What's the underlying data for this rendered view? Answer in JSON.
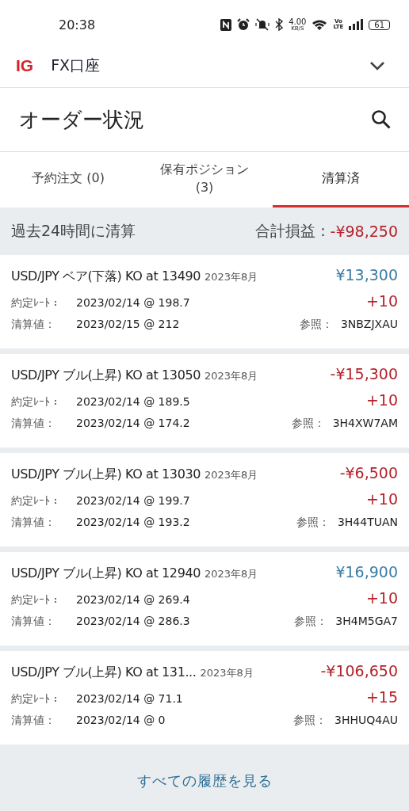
{
  "status_bar": {
    "time": "20:38",
    "speed_value": "4.00",
    "speed_unit": "KB/S",
    "volte_top": "Vo",
    "volte_bottom": "LTE",
    "battery": "61"
  },
  "account_bar": {
    "logo": "IG",
    "title": "FX口座"
  },
  "page": {
    "title": "オーダー状況"
  },
  "tabs": [
    {
      "label": "予約注文 (0)",
      "selected": false
    },
    {
      "label": "保有ポジション\n(3)",
      "selected": false
    },
    {
      "label": "清算済",
      "selected": true
    }
  ],
  "summary": {
    "label": "過去24時間に清算",
    "total_label": "合計損益：",
    "total_value": "-¥98,250"
  },
  "trades": [
    {
      "name": "USD/JPY ベア(下落) KO at 13490",
      "expiry": "2023年8月",
      "pnl": "¥13,300",
      "color": "#3a7ca5",
      "size": "+10",
      "open_label": "約定ﾚｰﾄ：",
      "open_value": "2023/02/14 @ 198.7",
      "close_label": "清算値：",
      "close_value": "2023/02/15 @ 212",
      "ref_label": "参照：",
      "ref_value": "3NBZJXAU"
    },
    {
      "name": "USD/JPY ブル(上昇) KO at 13050",
      "expiry": "2023年8月",
      "pnl": "-¥15,300",
      "color": "#b3222a",
      "size": "+10",
      "open_label": "約定ﾚｰﾄ：",
      "open_value": "2023/02/14 @ 189.5",
      "close_label": "清算値：",
      "close_value": "2023/02/14 @ 174.2",
      "ref_label": "参照：",
      "ref_value": "3H4XW7AM"
    },
    {
      "name": "USD/JPY ブル(上昇) KO at 13030",
      "expiry": "2023年8月",
      "pnl": "-¥6,500",
      "color": "#b3222a",
      "size": "+10",
      "open_label": "約定ﾚｰﾄ：",
      "open_value": "2023/02/14 @ 199.7",
      "close_label": "清算値：",
      "close_value": "2023/02/14 @ 193.2",
      "ref_label": "参照：",
      "ref_value": "3H44TUAN"
    },
    {
      "name": "USD/JPY ブル(上昇) KO at 12940",
      "expiry": "2023年8月",
      "pnl": "¥16,900",
      "color": "#3a7ca5",
      "size": "+10",
      "open_label": "約定ﾚｰﾄ：",
      "open_value": "2023/02/14 @ 269.4",
      "close_label": "清算値：",
      "close_value": "2023/02/14 @ 286.3",
      "ref_label": "参照：",
      "ref_value": "3H4M5GA7"
    },
    {
      "name": "USD/JPY ブル(上昇) KO at 131...",
      "expiry": "2023年8月",
      "pnl": "-¥106,650",
      "color": "#b3222a",
      "size": "+15",
      "open_label": "約定ﾚｰﾄ：",
      "open_value": "2023/02/14 @ 71.1",
      "close_label": "清算値：",
      "close_value": "2023/02/14 @ 0",
      "ref_label": "参照：",
      "ref_value": "3HHUQ4AU"
    }
  ],
  "footer": {
    "link": "すべての履歴を見る"
  }
}
